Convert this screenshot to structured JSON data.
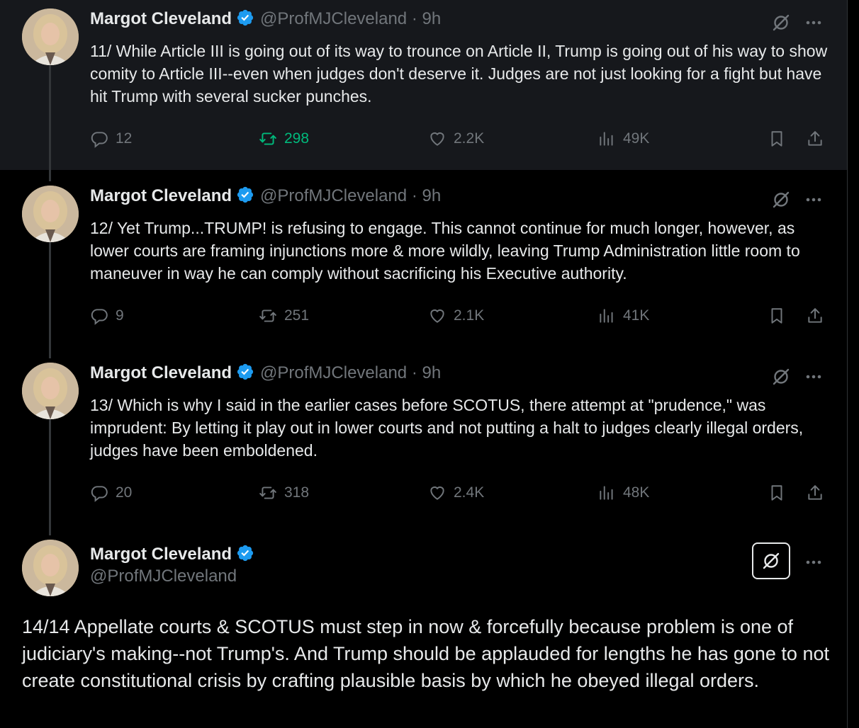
{
  "tweets": [
    {
      "name": "Margot Cleveland",
      "handle": "@ProfMJCleveland",
      "dot": "·",
      "time": "9h",
      "text": "11/ While Article III is going out of its way to trounce on Article II, Trump is going out of his way to show comity to Article III--even when judges don't deserve it. Judges are not just looking for a fight but have hit Trump with several sucker punches.",
      "replies": "12",
      "reposts": "298",
      "likes": "2.2K",
      "views": "49K"
    },
    {
      "name": "Margot Cleveland",
      "handle": "@ProfMJCleveland",
      "dot": "·",
      "time": "9h",
      "text": "12/ Yet Trump...TRUMP! is refusing to engage. This cannot continue for much longer, however, as lower courts are framing injunctions more & more wildly,  leaving Trump Administration little room to maneuver in way he can comply without sacrificing his Executive authority.",
      "replies": "9",
      "reposts": "251",
      "likes": "2.1K",
      "views": "41K"
    },
    {
      "name": "Margot Cleveland",
      "handle": "@ProfMJCleveland",
      "dot": "·",
      "time": "9h",
      "text": "13/ Which is why I said in the earlier cases before SCOTUS, there attempt at \"prudence,\" was imprudent: By letting it play out in lower courts and not putting a halt to judges clearly illegal orders, judges have been emboldened.",
      "replies": "20",
      "reposts": "318",
      "likes": "2.4K",
      "views": "48K"
    }
  ],
  "main_tweet": {
    "name": "Margot Cleveland",
    "handle": "@ProfMJCleveland",
    "text": "14/14 Appellate courts & SCOTUS must step in now & forcefully because problem is one of judiciary's  making--not Trump's. And Trump should be applauded for lengths he has gone to not create constitutional crisis by crafting plausible basis by which he obeyed illegal orders."
  },
  "colors": {
    "background": "#000000",
    "highlight_bg": "#16181c",
    "text": "#e7e9ea",
    "muted": "#71767b",
    "verified": "#1d9bf0",
    "repost_active": "#00ba7c"
  },
  "icons": [
    "verified-badge-icon",
    "grok-icon",
    "more-icon",
    "reply-icon",
    "repost-icon",
    "like-icon",
    "views-icon",
    "bookmark-icon",
    "share-icon"
  ]
}
